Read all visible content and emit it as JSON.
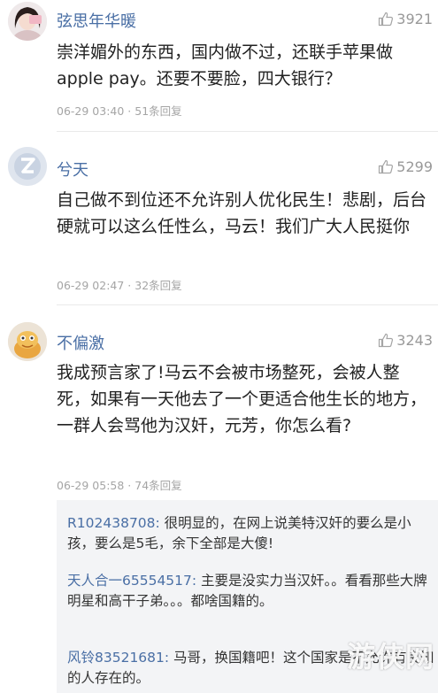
{
  "comments": [
    {
      "username": "弦思年华暖",
      "likes": "3921",
      "text": "崇洋媚外的东西，国内做不过，还联手苹果做apple pay。还要不要脸，四大银行？",
      "meta": "06-29 03:40 · 51条回复"
    },
    {
      "username": "兮天",
      "likes": "5299",
      "text": "自己做不到位还不允许别人优化民生！悲剧，后台硬就可以这么任性么，马云！我们广大人民挺你",
      "meta": "06-29 02:47 · 32条回复"
    },
    {
      "username": "不偏激",
      "likes": "3243",
      "text": "我成预言家了!马云不会被市场整死，会被人整死，如果有一天他去了一个更适合他生长的地方，一群人会骂他为汉奸，元芳，你怎么看?",
      "meta": "06-29 05:58 · 74条回复"
    }
  ],
  "replies": [
    {
      "name": "R102438708:",
      "text": " 很明显的，在网上说美特汉奸的要么是小孩，要么是5毛，余下全部是大傻!"
    },
    {
      "name": "天人合一65554517:",
      "text": " 主要是没实力当汉奸。。看看那些大牌明星和高干子弟。。。都啥国籍的。"
    },
    {
      "name": "风铃83521681:",
      "text": " 马哥，换国籍吧！这个国家是不允许有良知的人存在的。"
    }
  ],
  "watermark": "游侠网",
  "colors": {
    "username": "#4a6fa5",
    "meta": "#a5a5a5",
    "reply_bg": "#f3f4f6"
  },
  "icons": {
    "like": "thumbs-up-icon"
  }
}
